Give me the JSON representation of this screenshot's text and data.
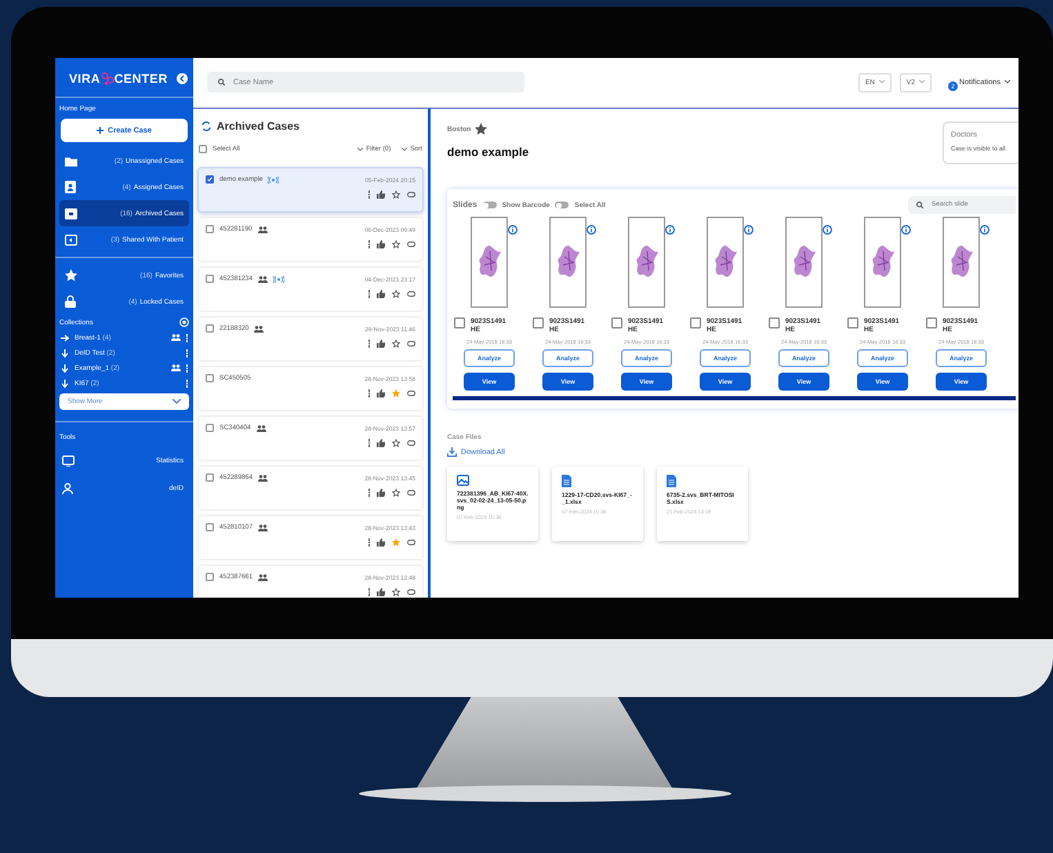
{
  "sidebar": {
    "logo": {
      "left": "VIRA",
      "right": "CENTER"
    },
    "home_label": "Home Page",
    "create_button": "Create Case",
    "nav": [
      {
        "kind": "folder",
        "count": "(2)",
        "label": "Unassigned Cases",
        "selected": false
      },
      {
        "kind": "assigned",
        "count": "(4)",
        "label": "Assigned Cases",
        "selected": false
      },
      {
        "kind": "archive",
        "count": "(16)",
        "label": "Archived Cases",
        "selected": true
      },
      {
        "kind": "shared",
        "count": "(3)",
        "label": "Shared With Patient",
        "selected": false
      },
      {
        "kind": "star",
        "count": "(16)",
        "label": "Favorites",
        "selected": false
      },
      {
        "kind": "lock",
        "count": "(4)",
        "label": "Locked Cases",
        "selected": false
      }
    ],
    "collections": {
      "title": "Collections",
      "items": [
        {
          "name": "Breast-1",
          "count": "(4)",
          "expanded": false,
          "shared": true
        },
        {
          "name": "DeID Test",
          "count": "(2)",
          "expanded": true,
          "shared": false
        },
        {
          "name": "Example_1",
          "count": "(2)",
          "expanded": true,
          "shared": true
        },
        {
          "name": "KI67",
          "count": "(2)",
          "expanded": true,
          "shared": false
        }
      ],
      "show_more": "Show More"
    },
    "tools": {
      "title": "Tools",
      "items": [
        {
          "kind": "chart",
          "label": "Statistics"
        },
        {
          "kind": "user",
          "label": "deID"
        }
      ]
    }
  },
  "top_bar": {
    "search_placeholder": "Case Name",
    "language": "EN",
    "version": "V2",
    "notifications": {
      "label": "Notifications",
      "count": "2"
    }
  },
  "case_list": {
    "title": "Archived Cases",
    "select_all": "Select All",
    "select_all_checked": false,
    "filter": "Filter (0)",
    "sort": "Sort",
    "cases": [
      {
        "name": "demo example",
        "date": "05-Feb-2024 20:15",
        "shared": false,
        "synced": true,
        "starred": false,
        "checked": true,
        "selected": true
      },
      {
        "name": "452281190",
        "date": "06-Dec-2023 09:49",
        "shared": true,
        "synced": false,
        "starred": false,
        "checked": false,
        "selected": false
      },
      {
        "name": "452381234",
        "date": "04-Dec-2023 23:17",
        "shared": true,
        "synced": true,
        "starred": false,
        "checked": false,
        "selected": false
      },
      {
        "name": "22188320",
        "date": "29-Nov-2023 11:46",
        "shared": true,
        "synced": false,
        "starred": false,
        "checked": false,
        "selected": false
      },
      {
        "name": "SC450505",
        "date": "28-Nov-2023 13:58",
        "shared": false,
        "synced": false,
        "starred": true,
        "checked": false,
        "selected": false
      },
      {
        "name": "SC340404",
        "date": "28-Nov-2023 13:57",
        "shared": true,
        "synced": false,
        "starred": false,
        "checked": false,
        "selected": false
      },
      {
        "name": "452289864",
        "date": "28-Nov-2023 13:45",
        "shared": true,
        "synced": false,
        "starred": false,
        "checked": false,
        "selected": false
      },
      {
        "name": "452810107",
        "date": "28-Nov-2023 13:43",
        "shared": true,
        "synced": false,
        "starred": true,
        "checked": false,
        "selected": false
      },
      {
        "name": "452387661",
        "date": "28-Nov-2023 12:48",
        "shared": true,
        "synced": false,
        "starred": false,
        "checked": false,
        "selected": false
      }
    ]
  },
  "case": {
    "location": "Boston",
    "title": "demo example",
    "doctors": {
      "title": "Doctors",
      "text": "Case is visible to all"
    },
    "slides": {
      "title": "Slides",
      "show_barcode": {
        "label": "Show Barcode",
        "on": false
      },
      "select_all": {
        "label": "Select All",
        "on": false
      },
      "search_placeholder": "Search slide",
      "items": [
        {
          "id": "9023S1491",
          "stain": "HE",
          "date": "24-May-2018 16:33",
          "checked": false,
          "analyze": "Analyze",
          "view": "View"
        },
        {
          "id": "9023S1491",
          "stain": "HE",
          "date": "24-May-2018 16:33",
          "checked": false,
          "analyze": "Analyze",
          "view": "View"
        },
        {
          "id": "9023S1491",
          "stain": "HE",
          "date": "24-May-2018 16:33",
          "checked": false,
          "analyze": "Analyze",
          "view": "View"
        },
        {
          "id": "9023S1491",
          "stain": "HE",
          "date": "24-May-2018 16:33",
          "checked": false,
          "analyze": "Analyze",
          "view": "View"
        },
        {
          "id": "9023S1491",
          "stain": "HE",
          "date": "24-May-2018 16:33",
          "checked": false,
          "analyze": "Analyze",
          "view": "View"
        },
        {
          "id": "9023S1491",
          "stain": "HE",
          "date": "24-May-2018 16:33",
          "checked": false,
          "analyze": "Analyze",
          "view": "View"
        },
        {
          "id": "9023S1491",
          "stain": "HE",
          "date": "24-May-2018 16:33",
          "checked": false,
          "analyze": "Analyze",
          "view": "View"
        }
      ]
    },
    "files": {
      "title": "Case Files",
      "download_all": "Download All",
      "items": [
        {
          "kind": "image",
          "name": "722381396_AB_KI67-40X.svs_02-02-24_13-05-50.png",
          "date": "07-Feb-2024 15:36"
        },
        {
          "kind": "document",
          "name": "1229-17-CD20.svs-KI67_-_1.xlsx",
          "date": "07-Feb-2024 15:36"
        },
        {
          "kind": "document",
          "name": "6735-2.svs_BRT-MITOSIS.xlsx",
          "date": "21-Feb-2024 13:16"
        }
      ]
    }
  }
}
